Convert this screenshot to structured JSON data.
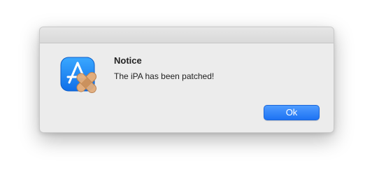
{
  "dialog": {
    "title": "Notice",
    "message": "The iPA has been patched!",
    "ok_label": "Ok",
    "icon": "app-store-bandage-icon"
  },
  "colors": {
    "dialog_bg": "#ececec",
    "button_accent": "#1d72f3",
    "icon_blue": "#1f8cf5"
  }
}
